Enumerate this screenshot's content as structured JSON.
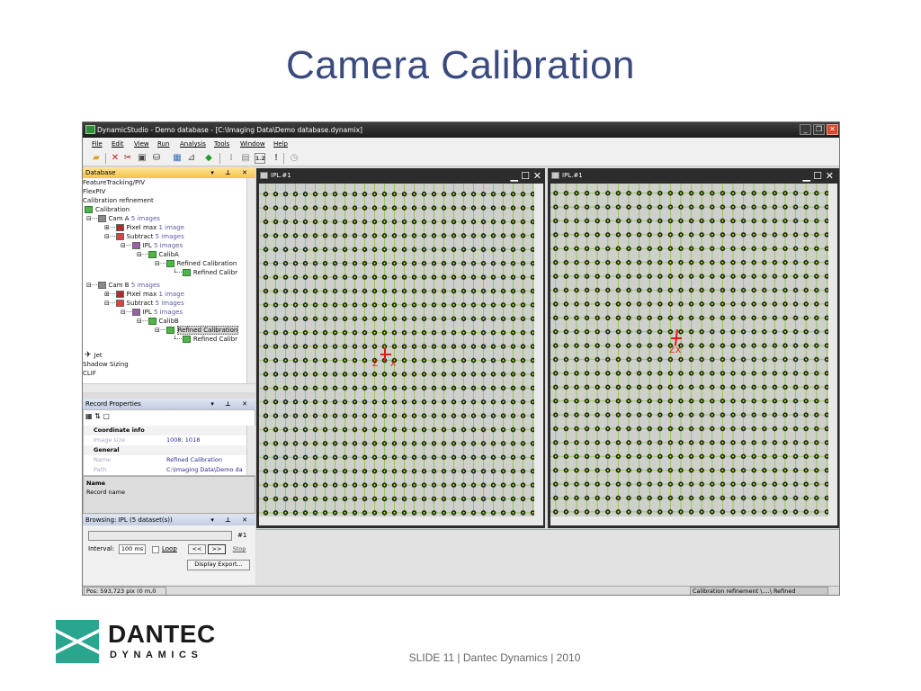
{
  "slide": {
    "title": "Camera Calibration",
    "footer": "SLIDE 11  |  Dantec Dynamics  |  2010",
    "logo": {
      "line1": "DANTEC",
      "line2": "DYNAMICS",
      "color": "#2aa58e"
    }
  },
  "app": {
    "window_title": "DynamicStudio - Demo database - [C:\\Imaging Data\\Demo database.dynamix]",
    "menu": [
      "File",
      "Edit",
      "View",
      "Run",
      "Analysis",
      "Tools",
      "Window",
      "Help"
    ],
    "toolbar_icons": [
      "open-icon",
      "delete-icon",
      "cut-icon",
      "properties-icon",
      "database-icon",
      "grid-icon",
      "chart-icon",
      "run-icon",
      "separator-icon",
      "camera-icon",
      "one-two-icon",
      "exclamation-icon",
      "clock-icon"
    ],
    "database_panel": {
      "title": "Database",
      "items": [
        {
          "label": "FeatureTracking/PIV",
          "count": ""
        },
        {
          "label": "FlexPIV",
          "count": ""
        },
        {
          "label": "Calibration refinement",
          "count": ""
        },
        {
          "label": "Calibration",
          "count": ""
        },
        {
          "label": "Cam A",
          "count": "5 images"
        },
        {
          "label": "Pixel max",
          "count": "1 image"
        },
        {
          "label": "Subtract",
          "count": "5 images"
        },
        {
          "label": "IPL",
          "count": "5 images"
        },
        {
          "label": "CalibA",
          "count": ""
        },
        {
          "label": "Refined Calibration",
          "count": ""
        },
        {
          "label": "Refined Calibr",
          "count": ""
        },
        {
          "label": "Cam B",
          "count": "5 images"
        },
        {
          "label": "Pixel max",
          "count": "1 image"
        },
        {
          "label": "Subtract",
          "count": "5 images"
        },
        {
          "label": "IPL",
          "count": "5 images"
        },
        {
          "label": "CalibB",
          "count": ""
        },
        {
          "label": "Refined Calibration",
          "count": ""
        },
        {
          "label": "Refined Calibr",
          "count": ""
        },
        {
          "label": "Jet",
          "count": ""
        },
        {
          "label": "Shadow Sizing",
          "count": ""
        },
        {
          "label": "CLIF",
          "count": ""
        }
      ]
    },
    "record_properties": {
      "title": "Record Properties",
      "rows": [
        {
          "type": "category",
          "label": "Coordinate info"
        },
        {
          "type": "prop",
          "label": "Image size",
          "value": "1008; 1018"
        },
        {
          "type": "category",
          "label": "General"
        },
        {
          "type": "prop",
          "label": "Name",
          "value": "Refined Calibration"
        },
        {
          "type": "prop",
          "label": "Path",
          "value": "C:\\Imaging Data\\Demo da"
        }
      ],
      "desc_title": "Name",
      "desc_text": "Record name"
    },
    "browsing": {
      "title": "Browsing: IPL (5 dataset(s))",
      "record": "#1",
      "interval_label": "Interval:",
      "interval_value": "100 ms",
      "loop_label": "Loop",
      "prev": "<<",
      "next": ">>",
      "stop": "Stop",
      "export": "Display Export..."
    },
    "image_windows": [
      {
        "title": "IPL.#1",
        "axis_labels": [
          "Z",
          "X"
        ]
      },
      {
        "title": "IPL.#1",
        "axis_labels": [
          "Z",
          "X"
        ]
      }
    ],
    "status": {
      "position": "Pos: 593,723 pix (0 m,0 m)",
      "path": "Calibration refinement \\....\\ Refined Calibration"
    }
  }
}
